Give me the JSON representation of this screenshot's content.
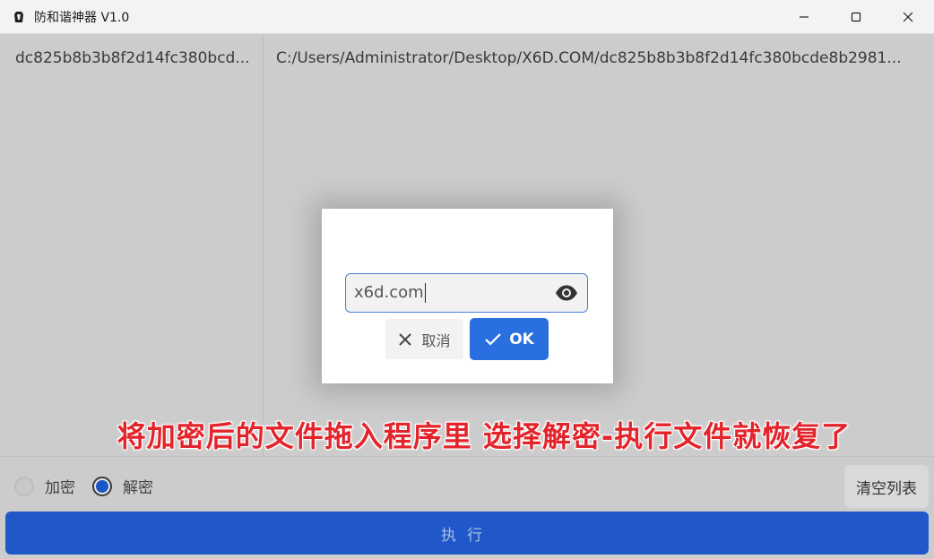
{
  "window": {
    "title": "防和谐神器 V1.0",
    "icon": "app-logo-icon",
    "controls": [
      "minimize-icon",
      "maximize-icon",
      "close-icon"
    ]
  },
  "file_list": {
    "left_item": "dc825b8b3b8f2d14fc380bcd...",
    "right_item": "C:/Users/Administrator/Desktop/X6D.COM/dc825b8b3b8f2d14fc380bcde8b2981..."
  },
  "options": {
    "encrypt_label": "加密",
    "decrypt_label": "解密",
    "selected": "解密"
  },
  "buttons": {
    "clear_list": "清空列表",
    "execute": "执行"
  },
  "dialog": {
    "password_value": "x6d.com",
    "cancel_label": "取消",
    "ok_label": "OK"
  },
  "overlay": {
    "caption": "将加密后的文件拖入程序里 选择解密-执行文件就恢复了"
  },
  "colors": {
    "accent": "#2158c9",
    "ok_button": "#2a6fe0",
    "caption": "#e3242b"
  }
}
